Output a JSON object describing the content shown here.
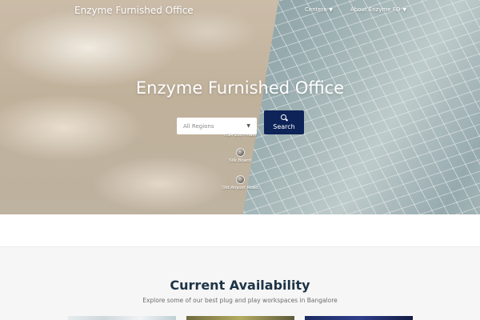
{
  "header": {
    "brand": "Enzyme Furnished Office",
    "nav": [
      {
        "label": "Centers"
      },
      {
        "label": "About Enzyme FO"
      }
    ]
  },
  "hero": {
    "title": "Enzyme Furnished Office",
    "search": {
      "selected_region": "All Regions",
      "button_label": "Search"
    },
    "locations": [
      {
        "name": "HSR 19th Main"
      },
      {
        "name": "Silk Board"
      },
      {
        "name": "Old Airport Road"
      }
    ]
  },
  "availability": {
    "title": "Current Availability",
    "subtitle": "Explore some of our best plug and play workspaces in Bangalore"
  },
  "colors": {
    "search_button": "#0e2358",
    "section_title": "#1e3447"
  }
}
